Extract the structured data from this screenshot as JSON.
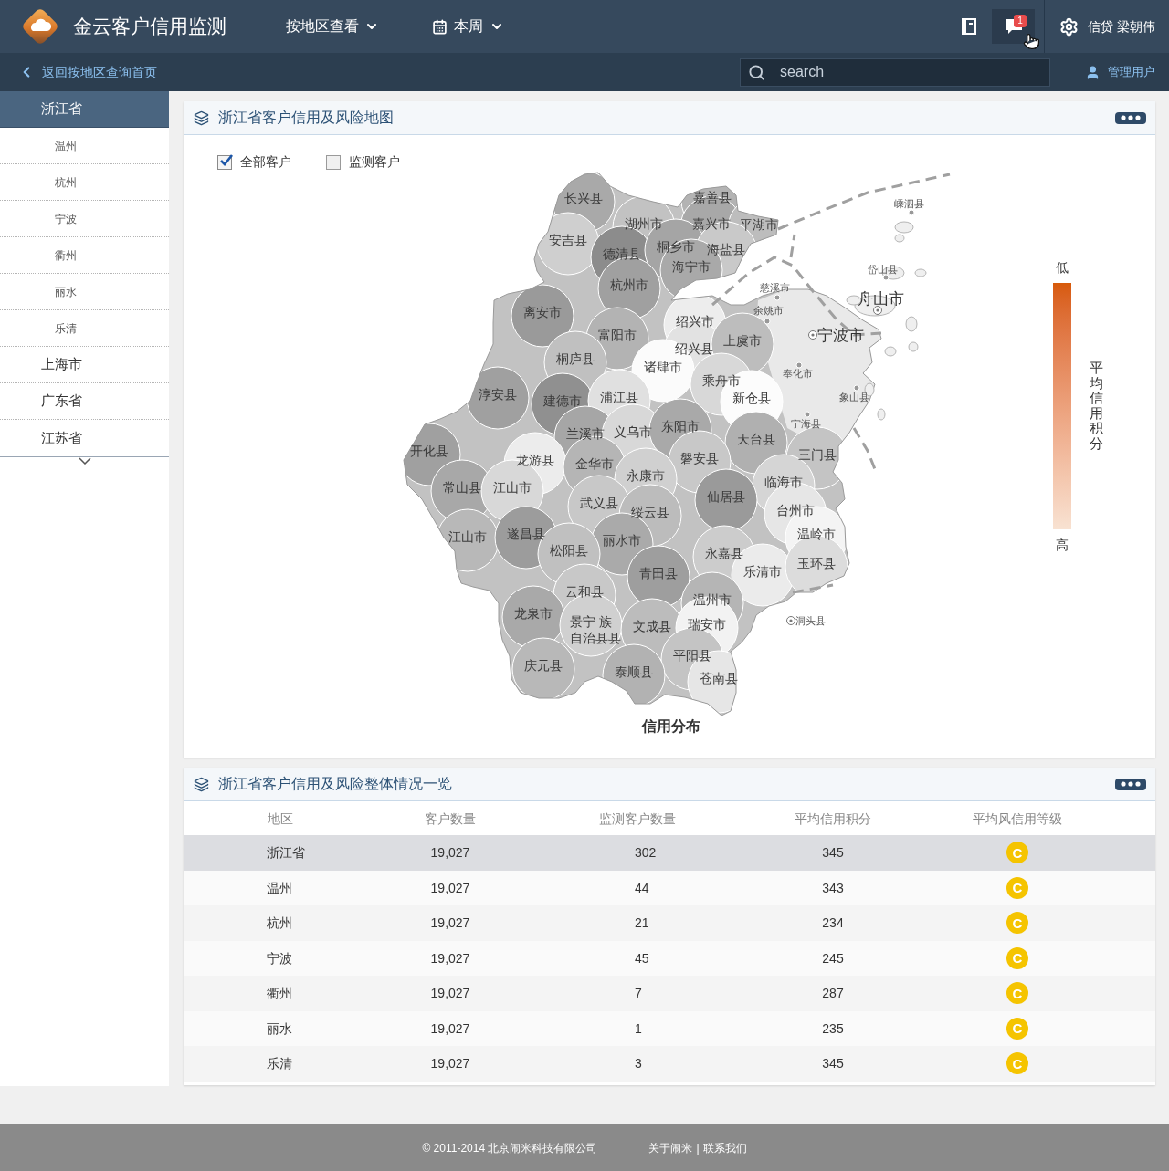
{
  "header": {
    "title": "金云客户信用监测",
    "nav": [
      {
        "label": "按地区查看",
        "kind": "dropdown"
      },
      {
        "label": "本周",
        "kind": "date"
      }
    ],
    "notification_count": "1",
    "user": "信贷 梁朝伟"
  },
  "subheader": {
    "back_link": "返回按地区查询首页",
    "search": {
      "placeholder": "search"
    },
    "admin_link": "管理用户"
  },
  "sidebar": {
    "items": [
      {
        "label": "浙江省",
        "selected": true,
        "children": [
          {
            "label": "温州",
            "selected": false
          },
          {
            "label": "杭州",
            "selected": false
          },
          {
            "label": "宁波",
            "selected": false
          },
          {
            "label": "衢州",
            "selected": false
          },
          {
            "label": "丽水",
            "selected": false
          },
          {
            "label": "乐清",
            "selected": false
          }
        ]
      },
      {
        "label": "上海市",
        "selected": false
      },
      {
        "label": "广东省",
        "selected": false
      },
      {
        "label": "江苏省",
        "selected": false
      }
    ]
  },
  "map_card": {
    "title": "浙江省客户信用及风险地图",
    "filters": [
      {
        "label": "全部客户",
        "checked": true
      },
      {
        "label": "监测客户",
        "checked": false
      }
    ],
    "map": {
      "title": "信用分布",
      "regions": [
        {
          "name": "长兴县",
          "kind": "area"
        },
        {
          "name": "嘉善县",
          "kind": "area"
        },
        {
          "name": "嵊泗县",
          "kind": "town"
        },
        {
          "name": "湖州市",
          "kind": "area"
        },
        {
          "name": "嘉兴市",
          "kind": "area"
        },
        {
          "name": "平湖市",
          "kind": "area"
        },
        {
          "name": "安吉县",
          "kind": "area"
        },
        {
          "name": "德清县",
          "kind": "area"
        },
        {
          "name": "桐乡市",
          "kind": "area"
        },
        {
          "name": "海盐县",
          "kind": "area"
        },
        {
          "name": "海宁市",
          "kind": "area"
        },
        {
          "name": "岱山县",
          "kind": "town"
        },
        {
          "name": "杭州市",
          "kind": "area"
        },
        {
          "name": "慈溪市",
          "kind": "town"
        },
        {
          "name": "舟山市",
          "kind": "city"
        },
        {
          "name": "离安市",
          "kind": "area"
        },
        {
          "name": "余姚市",
          "kind": "town"
        },
        {
          "name": "绍兴市",
          "kind": "area"
        },
        {
          "name": "富阳市",
          "kind": "area"
        },
        {
          "name": "绍兴县",
          "kind": "area"
        },
        {
          "name": "上虞市",
          "kind": "area"
        },
        {
          "name": "宁波市",
          "kind": "city"
        },
        {
          "name": "桐庐县",
          "kind": "area"
        },
        {
          "name": "诸肆市",
          "kind": "area"
        },
        {
          "name": "乘舟市",
          "kind": "area"
        },
        {
          "name": "奉化市",
          "kind": "town"
        },
        {
          "name": "淳安县",
          "kind": "area"
        },
        {
          "name": "建德市",
          "kind": "area"
        },
        {
          "name": "浦江县",
          "kind": "area"
        },
        {
          "name": "新仓县",
          "kind": "area"
        },
        {
          "name": "象山县",
          "kind": "town"
        },
        {
          "name": "兰溪市",
          "kind": "area"
        },
        {
          "name": "义乌市",
          "kind": "area"
        },
        {
          "name": "东阳市",
          "kind": "area"
        },
        {
          "name": "宁海县",
          "kind": "town"
        },
        {
          "name": "天台县",
          "kind": "area"
        },
        {
          "name": "开化县",
          "kind": "area"
        },
        {
          "name": "龙游县",
          "kind": "area"
        },
        {
          "name": "金华市",
          "kind": "area"
        },
        {
          "name": "磐安县",
          "kind": "area"
        },
        {
          "name": "三门县",
          "kind": "area"
        },
        {
          "name": "常山县",
          "kind": "area"
        },
        {
          "name": "江山市",
          "kind": "area"
        },
        {
          "name": "永康市",
          "kind": "area"
        },
        {
          "name": "临海市",
          "kind": "area"
        },
        {
          "name": "武义县",
          "kind": "area"
        },
        {
          "name": "仙居县",
          "kind": "area"
        },
        {
          "name": "绥云县",
          "kind": "area"
        },
        {
          "name": "台州市",
          "kind": "area"
        },
        {
          "name": "江山市",
          "kind": "area"
        },
        {
          "name": "遂昌县",
          "kind": "area"
        },
        {
          "name": "丽水市",
          "kind": "area"
        },
        {
          "name": "温岭市",
          "kind": "area"
        },
        {
          "name": "松阳县",
          "kind": "area"
        },
        {
          "name": "永嘉县",
          "kind": "area"
        },
        {
          "name": "青田县",
          "kind": "area"
        },
        {
          "name": "乐清市",
          "kind": "area"
        },
        {
          "name": "玉环县",
          "kind": "area"
        },
        {
          "name": "云和县",
          "kind": "area"
        },
        {
          "name": "温州市",
          "kind": "area"
        },
        {
          "name": "龙泉市",
          "kind": "area"
        },
        {
          "name": "景宁 族",
          "kind": "area"
        },
        {
          "name": "文成县",
          "kind": "area"
        },
        {
          "name": "瑞安市",
          "kind": "area"
        },
        {
          "name": "洞头县",
          "kind": "town"
        },
        {
          "name": "自治县县",
          "kind": "area"
        },
        {
          "name": "庆元县",
          "kind": "area"
        },
        {
          "name": "平阳县",
          "kind": "area"
        },
        {
          "name": "泰顺县",
          "kind": "area"
        },
        {
          "name": "苍南县",
          "kind": "area"
        }
      ]
    },
    "legend": {
      "top_label": "低",
      "bottom_label": "高",
      "title": "平均信用积分"
    }
  },
  "table_card": {
    "title": "浙江省客户信用及风险整体情况一览",
    "columns": [
      "地区",
      "客户数量",
      "监测客户数量",
      "平均信用积分",
      "平均风信用等级"
    ],
    "rows": [
      {
        "region": "浙江省",
        "customers": "19,027",
        "monitored": "302",
        "avg_score": "345",
        "grade": "C",
        "selected": true
      },
      {
        "region": "温州",
        "customers": "19,027",
        "monitored": "44",
        "avg_score": "343",
        "grade": "C",
        "selected": false
      },
      {
        "region": "杭州",
        "customers": "19,027",
        "monitored": "21",
        "avg_score": "234",
        "grade": "C",
        "selected": false
      },
      {
        "region": "宁波",
        "customers": "19,027",
        "monitored": "45",
        "avg_score": "245",
        "grade": "C",
        "selected": false
      },
      {
        "region": "衢州",
        "customers": "19,027",
        "monitored": "7",
        "avg_score": "287",
        "grade": "C",
        "selected": false
      },
      {
        "region": "丽水",
        "customers": "19,027",
        "monitored": "1",
        "avg_score": "235",
        "grade": "C",
        "selected": false
      },
      {
        "region": "乐清",
        "customers": "19,027",
        "monitored": "3",
        "avg_score": "345",
        "grade": "C",
        "selected": false
      }
    ]
  },
  "footer": {
    "copyright": "© 2011-2014 北京闹米科技有限公司",
    "links": [
      "关于闹米",
      "联系我们"
    ],
    "separator": "|"
  }
}
